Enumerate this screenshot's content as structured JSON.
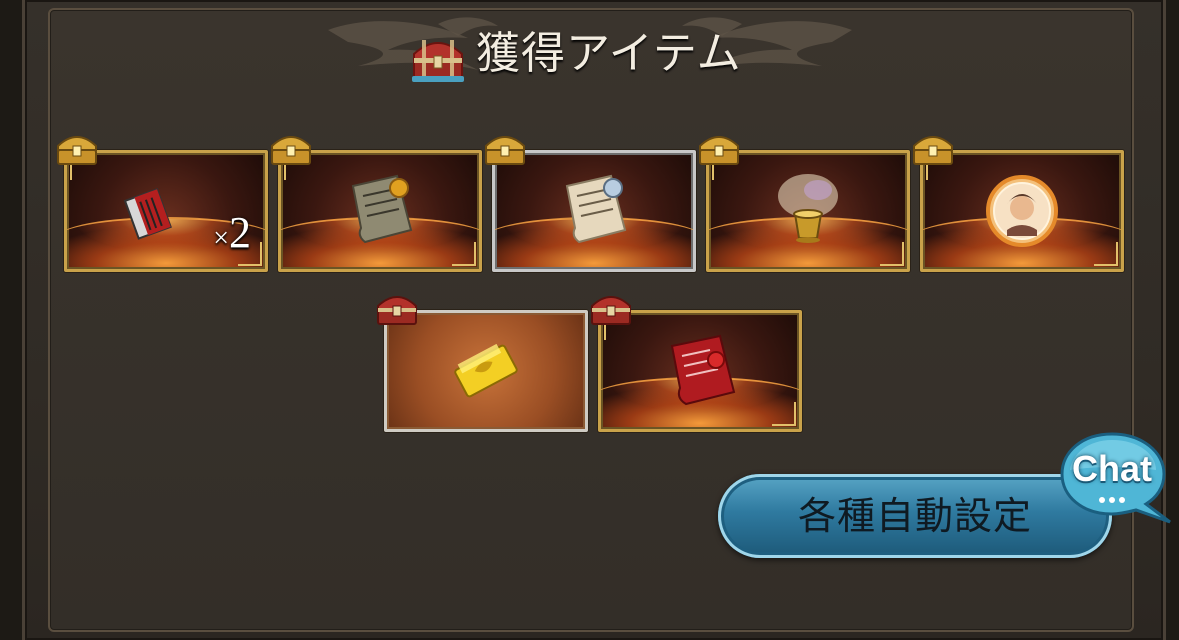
{
  "header": {
    "title": "獲得アイテム",
    "title_icon": "treasure-chest-icon"
  },
  "rewards": [
    {
      "name": "ticket-item",
      "quantity_label": "×2",
      "quantity_prefix": "×",
      "quantity_value": "2",
      "rarity_frame": "gold"
    },
    {
      "name": "gold-seal-scroll",
      "rarity_frame": "gold"
    },
    {
      "name": "silver-seal-scroll",
      "rarity_frame": "silver"
    },
    {
      "name": "golden-pot",
      "rarity_frame": "gold"
    },
    {
      "name": "character-orb",
      "rarity_frame": "gold"
    },
    {
      "name": "gold-bar",
      "rarity_frame": "bronze"
    },
    {
      "name": "red-seal-scroll",
      "rarity_frame": "gold"
    }
  ],
  "buttons": {
    "auto_settings": "各種自動設定",
    "chat": "Chat"
  },
  "colors": {
    "gold_frame": "#c9a24a",
    "silver_frame": "#c8c8c8",
    "button_blue": "#2f7aa0",
    "panel_bg": "#332e28"
  }
}
